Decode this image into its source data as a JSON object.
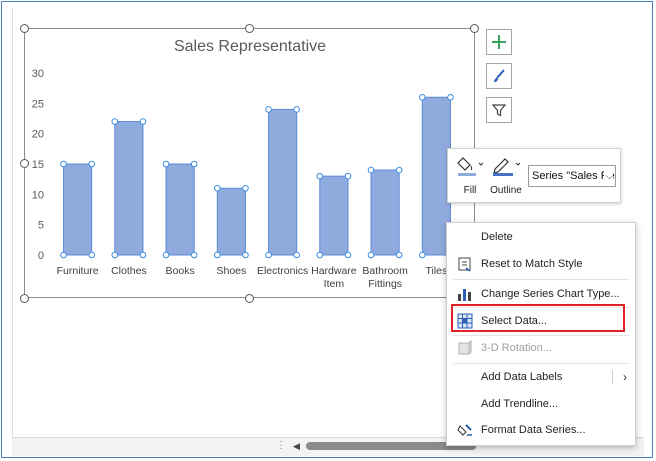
{
  "chart_data": {
    "type": "bar",
    "title": "Sales Representative",
    "categories": [
      "Furniture",
      "Clothes",
      "Books",
      "Shoes",
      "Electronics",
      "Hardware Item",
      "Bathroom Fittings",
      "Tiles"
    ],
    "category_lines": [
      [
        "Furniture"
      ],
      [
        "Clothes"
      ],
      [
        "Books"
      ],
      [
        "Shoes"
      ],
      [
        "Electronics"
      ],
      [
        "Hardware",
        "Item"
      ],
      [
        "Bathroom",
        "Fittings"
      ],
      [
        "Tiles"
      ]
    ],
    "values": [
      15,
      22,
      15,
      11,
      24,
      13,
      14,
      26
    ],
    "ylim": [
      0,
      30
    ],
    "yticks": [
      0,
      5,
      10,
      15,
      20,
      25,
      30
    ],
    "bar_color": "#8faadc",
    "bar_outline": "#5b8bd6",
    "grid": false,
    "legend": "none"
  },
  "chart_tools": {
    "add_element_icon": "plus-icon",
    "style_icon": "brush-icon",
    "filter_icon": "filter-icon"
  },
  "mini_toolbar": {
    "fill_label": "Fill",
    "outline_label": "Outline",
    "series_select_value": "Series \"Sales Re"
  },
  "context_menu": {
    "items": [
      {
        "label": "Delete",
        "icon": "none"
      },
      {
        "label": "Reset to Match Style",
        "icon": "reset-style-icon"
      },
      {
        "label": "Change Series Chart Type...",
        "icon": "chart-type-icon"
      },
      {
        "label": "Select Data...",
        "icon": "select-data-icon",
        "highlighted": true
      },
      {
        "label": "3-D Rotation...",
        "icon": "rotation-icon",
        "disabled": true
      },
      {
        "label": "Add Data Labels",
        "icon": "none",
        "submenu": true
      },
      {
        "label": "Add Trendline...",
        "icon": "none"
      },
      {
        "label": "Format Data Series...",
        "icon": "format-series-icon"
      }
    ]
  },
  "colors": {
    "accent": "#4472c4",
    "highlight_border": "#e0202a",
    "plus_icon": "#3aa05b"
  }
}
